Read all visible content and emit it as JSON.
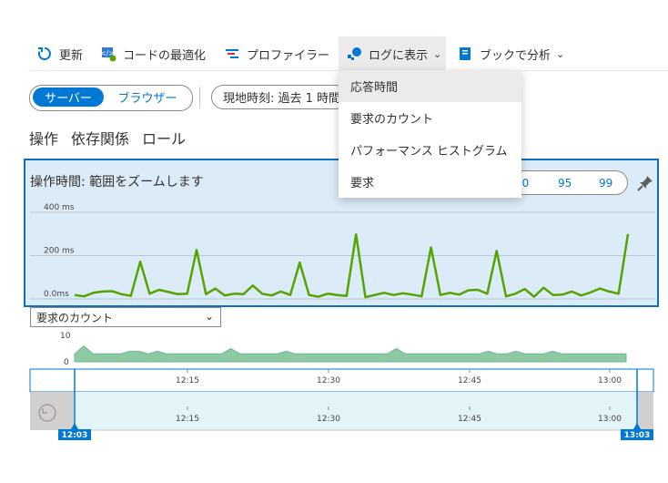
{
  "toolbar": {
    "refresh_label": "更新",
    "optimize_label": "コードの最適化",
    "profiler_label": "プロファイラー",
    "logs_label": "ログに表示",
    "workbook_label": "ブックで分析"
  },
  "filters": {
    "server_label": "サーバー",
    "browser_label": "ブラウザー",
    "time_label": "現地時刻: 過去 1 時間"
  },
  "tabs": [
    "操作",
    "依存関係",
    "ロール"
  ],
  "panel": {
    "title": "操作時間: 範囲をズームします",
    "percentiles": [
      "50",
      "95",
      "99"
    ]
  },
  "metric_dropdown": {
    "selected": "要求のカウント"
  },
  "logs_menu": {
    "items": [
      "応答時間",
      "要求のカウント",
      "パフォーマンス ヒストグラム",
      "要求"
    ]
  },
  "time_range": {
    "start": "12:03",
    "end": "13:03"
  },
  "colors": {
    "accent": "#0078d4",
    "line": "#57a300",
    "area": "#8cc9a4",
    "panel_bg": "#dcebf8"
  },
  "chart_data": [
    {
      "type": "line",
      "title": "操作時間",
      "y_ticks": [
        "400 ms",
        "200 ms",
        "0.0ms"
      ],
      "ylim": [
        0,
        400
      ],
      "series": [
        {
          "values": [
            18,
            12,
            28,
            34,
            36,
            22,
            14,
            172,
            24,
            42,
            32,
            22,
            24,
            226,
            22,
            48,
            16,
            24,
            22,
            62,
            24,
            16,
            34,
            18,
            168,
            18,
            10,
            24,
            18,
            14,
            298,
            8,
            18,
            28,
            18,
            26,
            20,
            12,
            238,
            18,
            28,
            20,
            40,
            42,
            24,
            222,
            12,
            24,
            46,
            10,
            52,
            18,
            20,
            34,
            16,
            30,
            48,
            34,
            24,
            300
          ]
        }
      ],
      "grid": true
    },
    {
      "type": "area",
      "title": "要求のカウント",
      "y_ticks": [
        "10",
        "0"
      ],
      "ylim": [
        0,
        10
      ],
      "x_ticks": [
        "12:15",
        "12:30",
        "12:45",
        "13:00"
      ],
      "series": [
        {
          "values": [
            3,
            6,
            3,
            3,
            3,
            3,
            4,
            4,
            3,
            4,
            3,
            3,
            3,
            3,
            3,
            3,
            3,
            5,
            3,
            3,
            3,
            3,
            3,
            4,
            3,
            3,
            3,
            3,
            3,
            3,
            3,
            3,
            3,
            3,
            3,
            5,
            3,
            3,
            3,
            3,
            3,
            3,
            3,
            3,
            3,
            4,
            3,
            3,
            4,
            3,
            3,
            3,
            4,
            3,
            3,
            3,
            3,
            3,
            3,
            3,
            3
          ]
        }
      ]
    }
  ]
}
